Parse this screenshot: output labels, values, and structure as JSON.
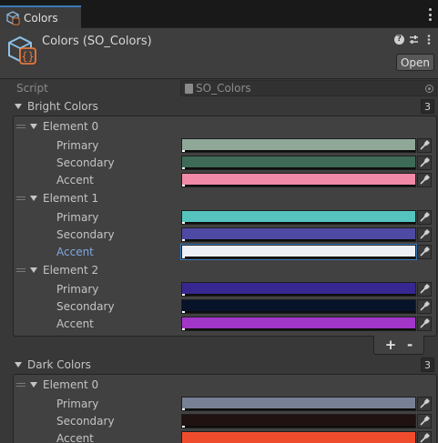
{
  "tab": {
    "title": "Colors"
  },
  "header": {
    "title": "Colors (SO_Colors)",
    "open_label": "Open"
  },
  "script_field": {
    "label": "Script",
    "value": "SO_Colors"
  },
  "bright_colors": {
    "label": "Bright Colors",
    "count": "3",
    "elements": [
      {
        "label": "Element 0",
        "fields": [
          {
            "label": "Primary",
            "color": "#8fa898"
          },
          {
            "label": "Secondary",
            "color": "#3e6b57"
          },
          {
            "label": "Accent",
            "color": "#f08aa6"
          }
        ]
      },
      {
        "label": "Element 1",
        "fields": [
          {
            "label": "Primary",
            "color": "#56c3bf"
          },
          {
            "label": "Secondary",
            "color": "#4e49a3"
          },
          {
            "label": "Accent",
            "color": "#ecf0f6"
          }
        ]
      },
      {
        "label": "Element 2",
        "fields": [
          {
            "label": "Primary",
            "color": "#372891"
          },
          {
            "label": "Secondary",
            "color": "#061329"
          },
          {
            "label": "Accent",
            "color": "#a236c9"
          }
        ]
      }
    ],
    "add_label": "+",
    "remove_label": "-"
  },
  "dark_colors": {
    "label": "Dark Colors",
    "count": "3",
    "elements": [
      {
        "label": "Element 0",
        "fields": [
          {
            "label": "Primary",
            "color": "#788096"
          },
          {
            "label": "Secondary",
            "color": "#1f1211"
          },
          {
            "label": "Accent",
            "color": "#ef4c2d"
          }
        ]
      }
    ]
  },
  "colors": {
    "accent_blue": "#3a79bb",
    "focused_label": "#7ea6e0"
  },
  "icons": {
    "tab": "scriptable-object-icon",
    "header": "scriptable-object-icon",
    "help": "help-icon",
    "presets": "sliders-icon",
    "menu": "kebab-menu-icon",
    "picker": "eyedropper-icon"
  }
}
